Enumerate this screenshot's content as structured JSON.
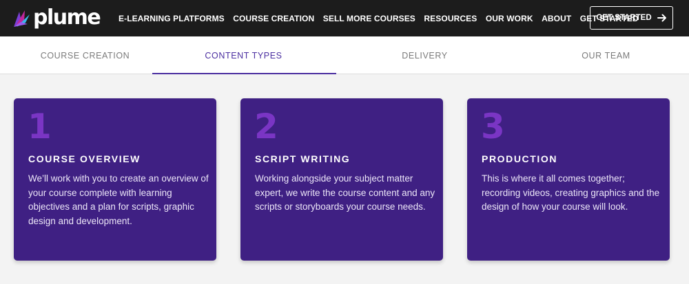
{
  "brand": {
    "name": "plume"
  },
  "nav": {
    "items": [
      "E-LEARNING PLATFORMS",
      "COURSE CREATION",
      "SELL MORE COURSES",
      "RESOURCES",
      "OUR WORK",
      "ABOUT",
      "GET STARTED"
    ],
    "cta_label": "GET STARTED",
    "cta_icon": "arrow-right-icon"
  },
  "tabs": {
    "items": [
      "COURSE CREATION",
      "CONTENT TYPES",
      "DELIVERY",
      "OUR TEAM"
    ],
    "active": "CONTENT TYPES"
  },
  "cards": [
    {
      "number": "1",
      "title": "COURSE OVERVIEW",
      "body": "We’ll work with you to create an overview of your course complete with learning objectives and a plan for scripts, graphic design and development."
    },
    {
      "number": "2",
      "title": "SCRIPT WRITING",
      "body": "Working alongside your subject matter expert, we write the course content and any scripts or storyboards your course needs."
    },
    {
      "number": "3",
      "title": "PRODUCTION",
      "body": "This is where it all comes together; recording videos, creating graphics and the design of how your course will look."
    }
  ],
  "colors": {
    "topbar": "#1c1c1c",
    "accent": "#4a2ea0",
    "card_bg": "#3f2083",
    "card_number": "#7a35c4",
    "page_bg": "#f3f3f3"
  }
}
